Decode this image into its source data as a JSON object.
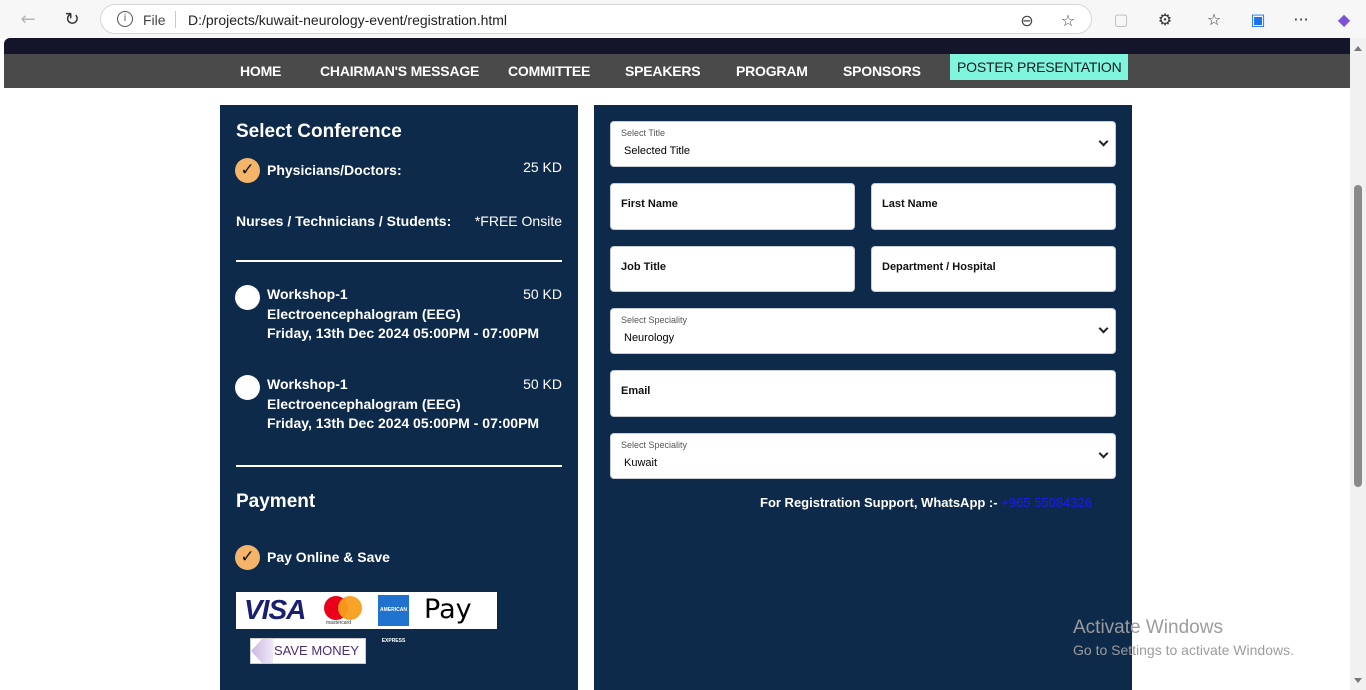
{
  "browser": {
    "back_icon": "←",
    "reload_icon": "↻",
    "info_icon": "i",
    "scheme_label": "File",
    "url": "D:/projects/kuwait-neurology-event/registration.html",
    "zoom_icon": "⊖",
    "star_icon": "☆",
    "extensions_icon": "⚙",
    "favorites_icon": "☆",
    "collections_icon": "▣",
    "more_icon": "···",
    "copilot_icon": "◆",
    "shield_icon": "▢"
  },
  "nav": {
    "items": [
      "HOME",
      "CHAIRMAN'S MESSAGE",
      "COMMITTEE",
      "SPEAKERS",
      "PROGRAM",
      "SPONSORS"
    ],
    "active": "POSTER PRESENTATION"
  },
  "conference": {
    "heading": "Select Conference",
    "check_glyph": "✓",
    "physicians_label": "Physicians/Doctors:",
    "physicians_price": "25 KD",
    "nurses_label": "Nurses / Technicians / Students:",
    "nurses_price": "*FREE Onsite",
    "workshops": [
      {
        "title": "Workshop-1",
        "subtitle": "Electroencephalogram (EEG)",
        "date": "Friday, 13th Dec 2024 05:00PM - 07:00PM",
        "price": "50 KD"
      },
      {
        "title": "Workshop-1",
        "subtitle": "Electroencephalogram (EEG)",
        "date": "Friday, 13th Dec 2024 05:00PM - 07:00PM",
        "price": "50 KD"
      }
    ]
  },
  "payment": {
    "heading": "Payment",
    "option_label": "Pay Online & Save",
    "visa": "VISA",
    "mastercard": "mastercard",
    "amex": "AMERICAN EXPRESS",
    "apple_pay": " Pay",
    "save_money": "SAVE MONEY"
  },
  "form": {
    "title_select": {
      "label": "Select Title",
      "value": "Selected Title"
    },
    "first_name": "First Name",
    "last_name": "Last Name",
    "job_title": "Job Title",
    "department": "Department / Hospital",
    "speciality_select": {
      "label": "Select Speciality",
      "value": "Neurology"
    },
    "email": "Email",
    "country_select": {
      "label": "Select Speciality",
      "value": "Kuwait"
    },
    "support_text": "For Registration Support, WhatsApp :- ",
    "support_phone": "+965 55084326"
  },
  "watermark": {
    "line1": "Activate Windows",
    "line2": "Go to Settings to activate Windows."
  }
}
